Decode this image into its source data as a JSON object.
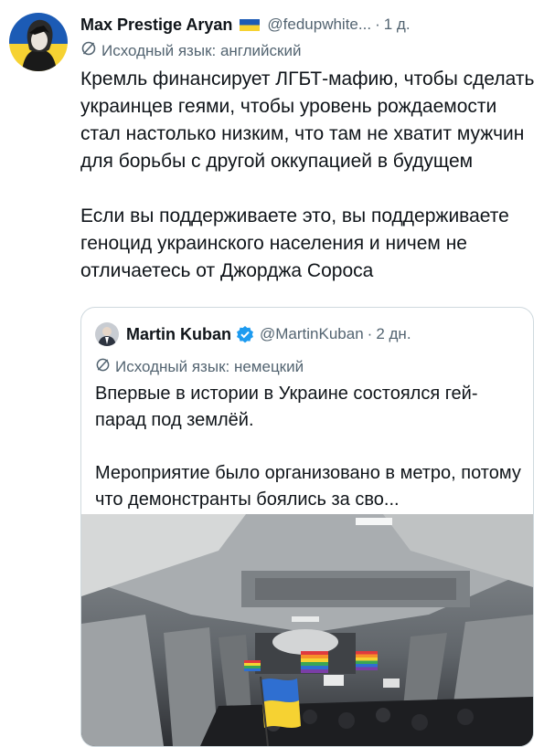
{
  "tweet": {
    "author_name": "Max Prestige Aryan",
    "handle": "@fedupwhite...",
    "separator": "·",
    "time": "1 д.",
    "source_language": "Исходный язык: английский",
    "paragraphs": [
      "Кремль финансирует ЛГБТ-мафию, чтобы сделать украинцев геями, чтобы уровень рождаемости стал настолько низким, что там не хватит мужчин для борьбы с другой оккупацией в будущем",
      "Если вы поддерживаете это, вы поддерживаете геноцид украинского населения и ничем не отличаетесь от Джорджа Сороса"
    ],
    "icons": {
      "flag": "ukraine-flag-icon",
      "translate": "translate-icon"
    },
    "colors": {
      "flag_blue": "#1c5bb5",
      "flag_yellow": "#f6d232"
    }
  },
  "quote": {
    "author_name": "Martin Kuban",
    "handle": "@MartinKuban",
    "separator": "·",
    "time": "2 дн.",
    "source_language": "Исходный язык: немецкий",
    "paragraphs": [
      "Впервые в истории в Украине состоялся гей-парад под землёй.",
      "Мероприятие было организовано в метро, потому что демонстранты боялись за сво..."
    ],
    "icons": {
      "verified": "verified-badge-icon",
      "translate": "translate-icon"
    },
    "colors": {
      "verified": "#1d9bf0"
    }
  }
}
